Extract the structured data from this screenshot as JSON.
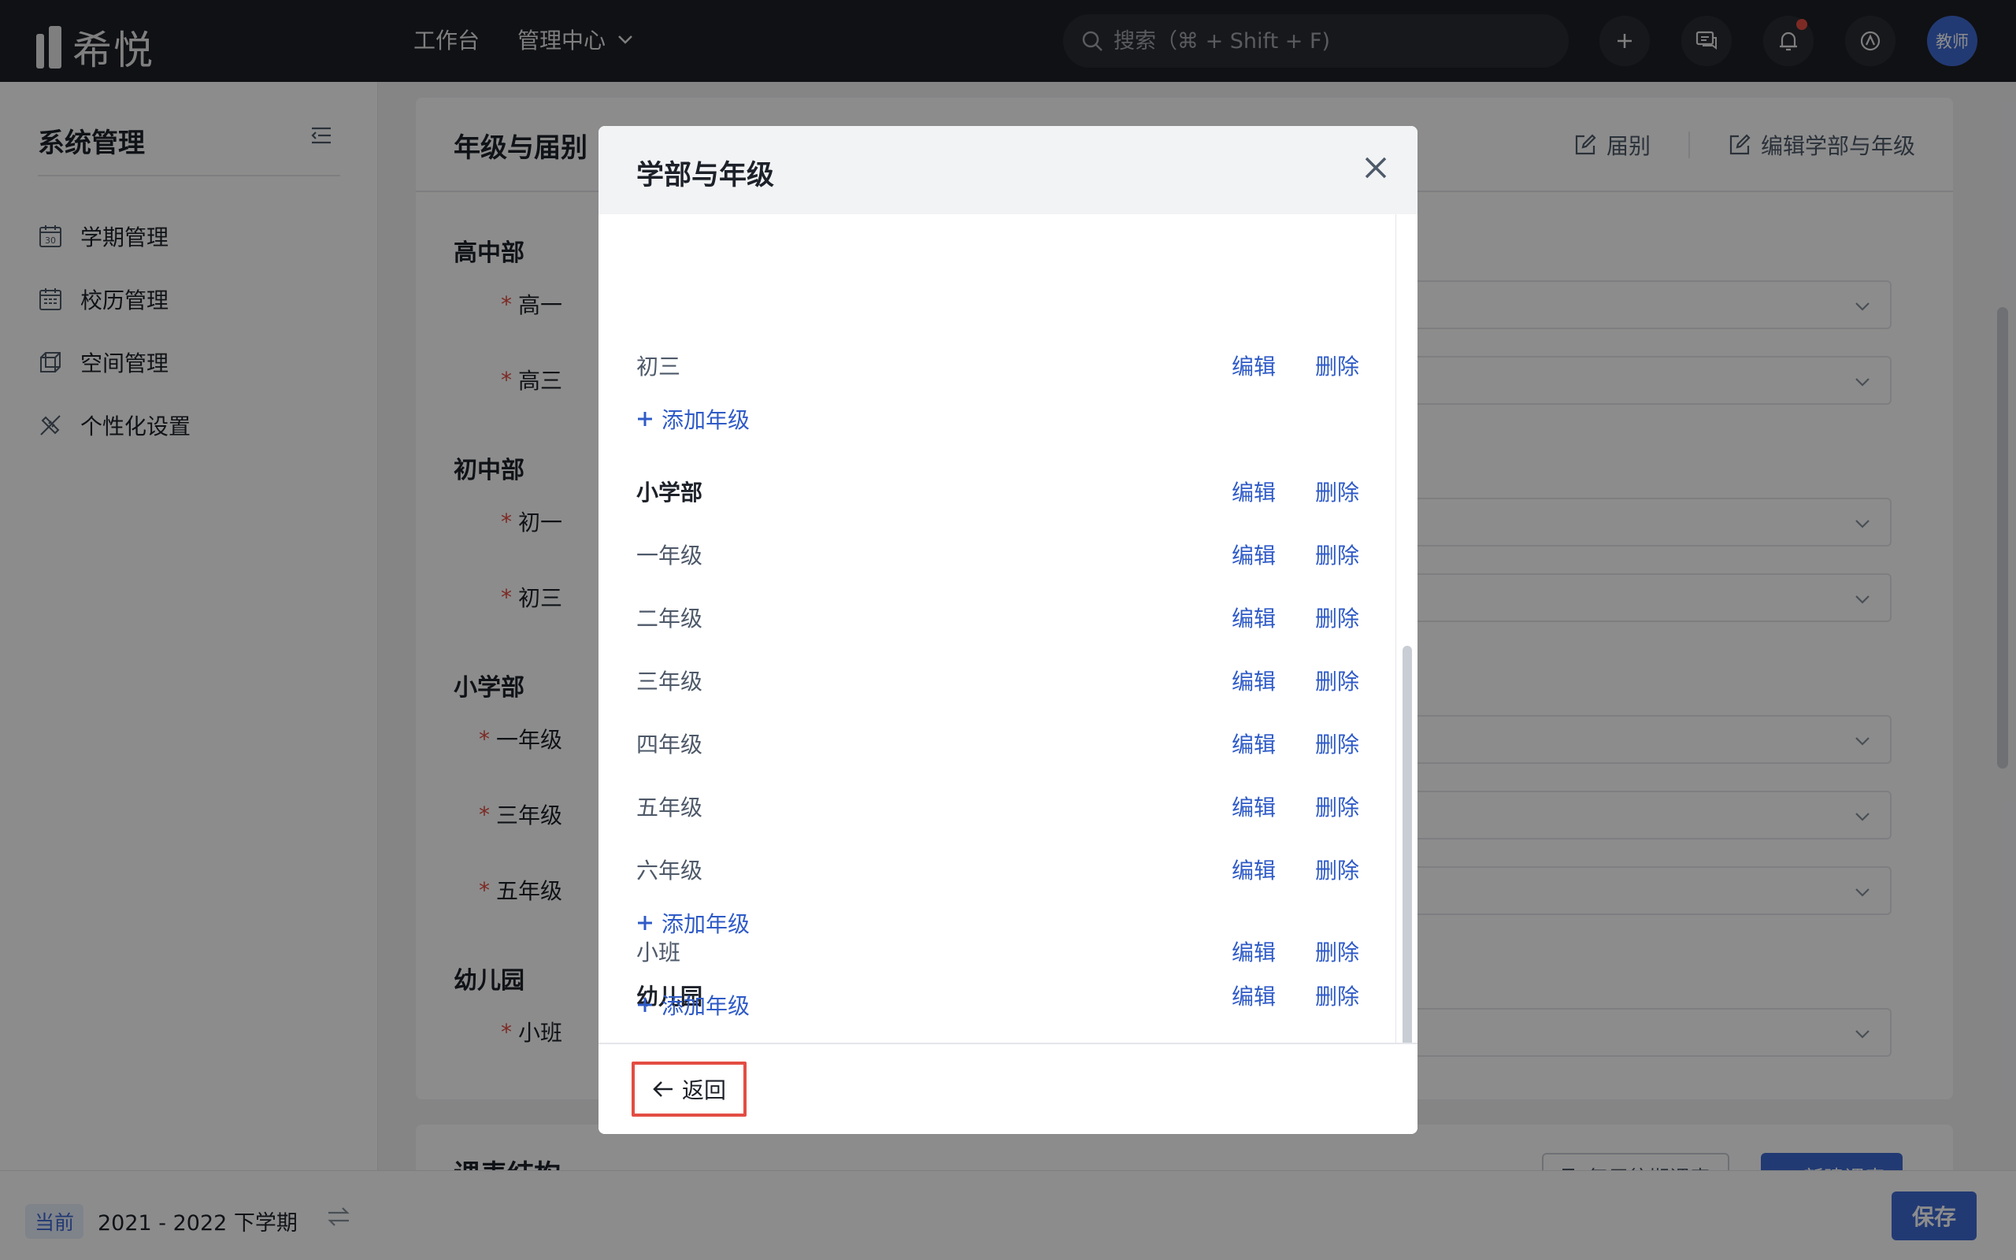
{
  "app": {
    "logo_text": "希悦"
  },
  "topnav": {
    "workbench": "工作台",
    "management_center": "管理中心"
  },
  "search": {
    "placeholder": "搜索（⌘ + Shift + F)"
  },
  "user": {
    "avatar_text": "教师"
  },
  "sidebar": {
    "title": "系统管理",
    "items": [
      {
        "label": "学期管理",
        "icon": "calendar-30-icon"
      },
      {
        "label": "校历管理",
        "icon": "calendar-grid-icon"
      },
      {
        "label": "空间管理",
        "icon": "cube-icon"
      },
      {
        "label": "个性化设置",
        "icon": "brush-ruler-icon"
      }
    ],
    "term_badge": "当前",
    "term_text": "2021 - 2022 下学期"
  },
  "card": {
    "title": "年级与届别",
    "action_session": "届别",
    "action_edit": "编辑学部与年级",
    "sections": [
      {
        "title": "高中部",
        "rows": [
          "高一",
          "高三"
        ]
      },
      {
        "title": "初中部",
        "rows": [
          "初一",
          "初三"
        ]
      },
      {
        "title": "小学部",
        "rows": [
          "一年级",
          "三年级",
          "五年级"
        ]
      },
      {
        "title": "幼儿园",
        "rows": [
          "小班"
        ]
      }
    ]
  },
  "card2": {
    "title": "课表结构",
    "reuse_label": "复用往期课表",
    "new_label": "新建课表"
  },
  "bottom": {
    "save_label": "保存"
  },
  "modal": {
    "title": "学部与年级",
    "edit_label": "编辑",
    "delete_label": "删除",
    "add_grade_label": "添加年级",
    "back_label": "返回",
    "rows": {
      "chu_san": "初三",
      "primary": "小学部",
      "g1": "一年级",
      "g2": "二年级",
      "g3": "三年级",
      "g4": "四年级",
      "g5": "五年级",
      "g6": "六年级",
      "kindergarten": "幼儿园",
      "small_class": "小班"
    }
  },
  "colors": {
    "accent": "#2f5bc7",
    "primary": "#3f6bd1",
    "required": "#e34d43",
    "topbar": "#1e2025"
  }
}
